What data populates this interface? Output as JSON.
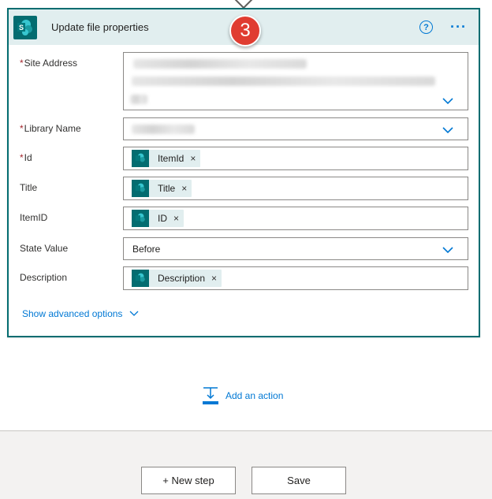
{
  "card": {
    "title": "Update file properties",
    "step_number": "3"
  },
  "fields": {
    "site_address": {
      "label": "Site Address",
      "required": "*"
    },
    "library_name": {
      "label": "Library Name",
      "required": "*"
    },
    "id": {
      "label": "Id",
      "required": "*",
      "token": "ItemId"
    },
    "title": {
      "label": "Title",
      "token": "Title"
    },
    "itemid": {
      "label": "ItemID",
      "token": "ID"
    },
    "state_value": {
      "label": "State Value",
      "selected": "Before"
    },
    "description": {
      "label": "Description",
      "token": "Description"
    }
  },
  "token_close_glyph": "×",
  "advanced_label": "Show advanced options",
  "add_action_label": "Add an action",
  "footer": {
    "new_step_label": "+ New step",
    "save_label": "Save"
  },
  "colors": {
    "brand_teal": "#036c70",
    "header_bg": "#e1eeef",
    "link_blue": "#0078d4",
    "badge_red": "#e03c31",
    "required_red": "#a4262c"
  },
  "icons": [
    "sharepoint-icon",
    "help-icon",
    "more-icon",
    "chevron-down-icon",
    "close-icon",
    "add-action-icon"
  ]
}
